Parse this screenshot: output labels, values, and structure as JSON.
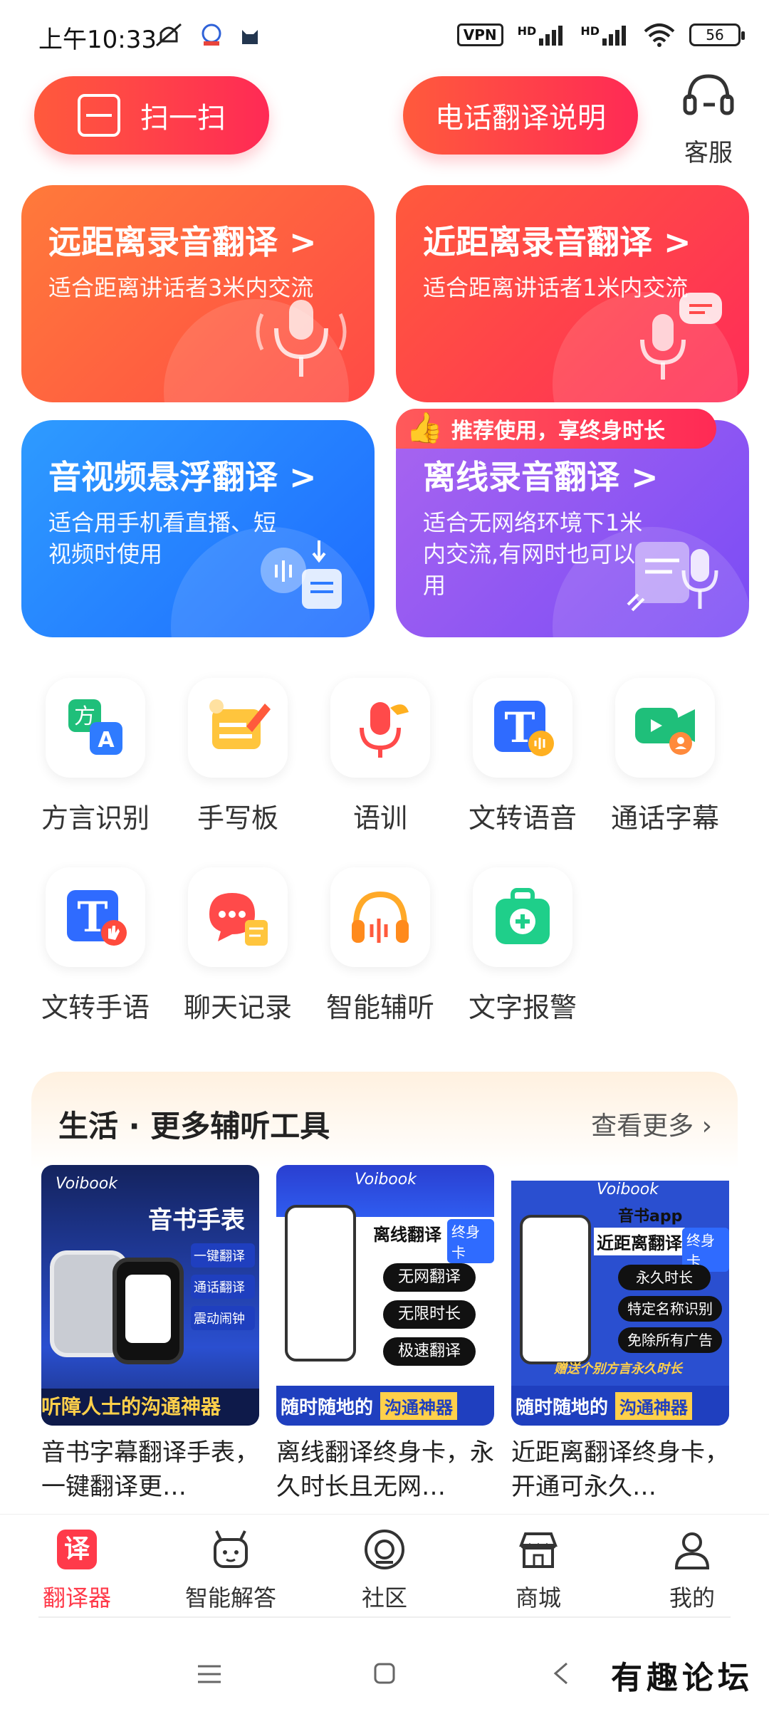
{
  "status_bar": {
    "time": "上午10:33",
    "vpn": "VPN",
    "signal_1": "HD",
    "signal_2": "HD",
    "battery": "56"
  },
  "top_actions": {
    "scan_label": "扫一扫",
    "call_translate_label": "电话翻译说明",
    "service_label": "客服"
  },
  "feature_cards": [
    {
      "title": "远距离录音翻译 >",
      "subtitle": "适合距离讲话者3米内交流"
    },
    {
      "title": "近距离录音翻译 >",
      "subtitle": "适合距离讲话者1米内交流"
    },
    {
      "title": "音视频悬浮翻译 >",
      "subtitle": "适合用手机看直播、短视频时使用"
    },
    {
      "title": "离线录音翻译 >",
      "subtitle": "适合无网络环境下1米内交流,有网时也可以用"
    }
  ],
  "promo_tag": "推荐使用，享终身时长",
  "tools": [
    {
      "label": "方言识别",
      "icon": "dialect-icon"
    },
    {
      "label": "手写板",
      "icon": "handwriting-icon"
    },
    {
      "label": "语训",
      "icon": "speech-training-icon"
    },
    {
      "label": "文转语音",
      "icon": "text-to-speech-icon"
    },
    {
      "label": "通话字幕",
      "icon": "call-subtitle-icon"
    },
    {
      "label": "文转手语",
      "icon": "text-to-sign-icon"
    },
    {
      "label": "聊天记录",
      "icon": "chat-history-icon"
    },
    {
      "label": "智能辅听",
      "icon": "hearing-aid-icon"
    },
    {
      "label": "文字报警",
      "icon": "text-alarm-icon"
    }
  ],
  "life_section": {
    "title": "生活 · 更多辅听工具",
    "more": "查看更多 ›",
    "products": [
      {
        "name": "音书字幕翻译手表，一键翻译更…",
        "brand": "Voibook",
        "headline": "音书手表",
        "tags": [
          "一键翻译",
          "通话翻译",
          "震动闹钟"
        ],
        "banner": "听障人士的沟通神器"
      },
      {
        "name": "离线翻译终身卡，永久时长且无网…",
        "brand": "Voibook",
        "headline": "离线翻译",
        "badge": "终身卡",
        "tags": [
          "无网翻译",
          "无限时长",
          "极速翻译"
        ],
        "banner": "随时随地的",
        "banner2": "沟通神器"
      },
      {
        "name": "近距离翻译终身卡，开通可永久…",
        "brand": "Voibook",
        "headline_top": "音书app",
        "headline": "近距离翻译",
        "badge": "终身卡",
        "tags": [
          "永久时长",
          "特定名称识别",
          "免除所有广告"
        ],
        "strip": "赠送个别方言永久时长",
        "banner": "随时随地的",
        "banner2": "沟通神器"
      }
    ]
  },
  "bottom_nav": [
    {
      "label": "翻译器",
      "icon_text": "译"
    },
    {
      "label": "智能解答"
    },
    {
      "label": "社区"
    },
    {
      "label": "商城"
    },
    {
      "label": "我的"
    }
  ],
  "watermark": "有趣论坛",
  "colors": {
    "accent": "#ff3a4a",
    "card_orange": "#ff6a3c",
    "card_blue": "#2e8bff",
    "card_purple": "#9059f2"
  }
}
